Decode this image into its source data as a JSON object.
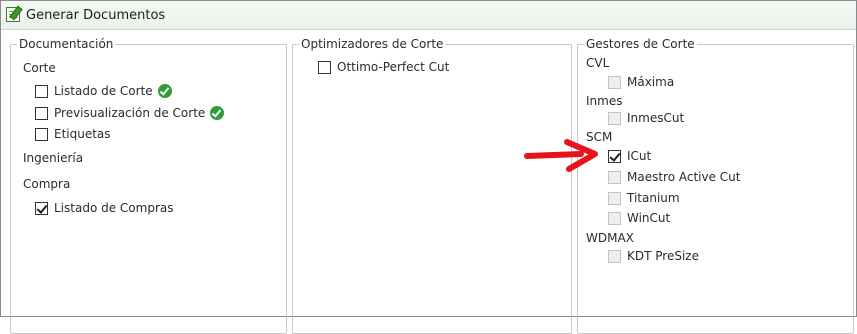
{
  "window": {
    "title": "Generar Documentos"
  },
  "documentacion": {
    "legend": "Documentación",
    "categories": [
      {
        "label": "Corte",
        "items": [
          {
            "label": "Listado de Corte",
            "checked": false,
            "status": "ok"
          },
          {
            "label": "Previsualización de Corte",
            "checked": false,
            "status": "ok"
          },
          {
            "label": "Etiquetas",
            "checked": false
          }
        ]
      },
      {
        "label": "Ingeniería",
        "items": []
      },
      {
        "label": "Compra",
        "items": [
          {
            "label": "Listado de Compras",
            "checked": true
          }
        ]
      }
    ]
  },
  "optimizadores": {
    "legend": "Optimizadores de Corte",
    "items": [
      {
        "label": "Ottimo-Perfect Cut",
        "checked": false
      }
    ]
  },
  "gestores": {
    "legend": "Gestores de Corte",
    "categories": [
      {
        "label": "CVL",
        "items": [
          {
            "label": "Máxima",
            "checked": false,
            "enabled": false
          }
        ]
      },
      {
        "label": "Inmes",
        "items": [
          {
            "label": "InmesCut",
            "checked": false,
            "enabled": false
          }
        ]
      },
      {
        "label": "SCM",
        "items": [
          {
            "label": "ICut",
            "checked": true,
            "enabled": true
          },
          {
            "label": "Maestro Active Cut",
            "checked": false,
            "enabled": false
          },
          {
            "label": "Titanium",
            "checked": false,
            "enabled": false
          },
          {
            "label": "WinCut",
            "checked": false,
            "enabled": false
          }
        ]
      },
      {
        "label": "WDMAX",
        "items": [
          {
            "label": "KDT PreSize",
            "checked": false,
            "enabled": false
          }
        ]
      }
    ]
  },
  "colors": {
    "status_ok": "#2e9d3a",
    "annotation_arrow": "#e8141c"
  }
}
